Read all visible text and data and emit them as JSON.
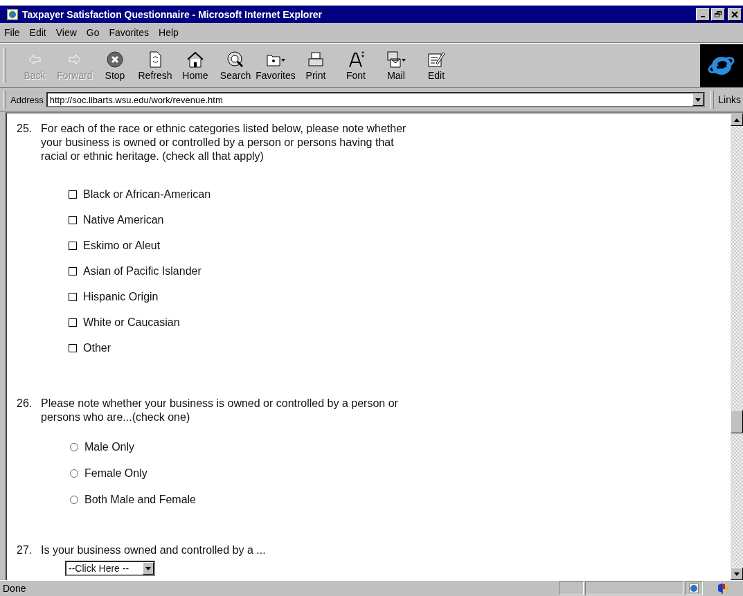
{
  "window": {
    "title": "Taxpayer Satisfaction Questionnaire - Microsoft Internet Explorer"
  },
  "menu": [
    "File",
    "Edit",
    "View",
    "Go",
    "Favorites",
    "Help"
  ],
  "toolbar": [
    {
      "kind": "back",
      "label": "Back",
      "disabled": true
    },
    {
      "kind": "forward",
      "label": "Forward",
      "disabled": true
    },
    {
      "kind": "stop",
      "label": "Stop",
      "disabled": false
    },
    {
      "kind": "refresh",
      "label": "Refresh",
      "disabled": false
    },
    {
      "kind": "home",
      "label": "Home",
      "disabled": false
    },
    {
      "kind": "search",
      "label": "Search",
      "disabled": false
    },
    {
      "kind": "favorites",
      "label": "Favorites",
      "disabled": false
    },
    {
      "kind": "print",
      "label": "Print",
      "disabled": false
    },
    {
      "kind": "font",
      "label": "Font",
      "disabled": false
    },
    {
      "kind": "mail",
      "label": "Mail",
      "disabled": false
    },
    {
      "kind": "edit",
      "label": "Edit",
      "disabled": false
    }
  ],
  "address": {
    "label": "Address",
    "value": "http://soc.libarts.wsu.edu/work/revenue.htm",
    "links": "Links"
  },
  "questions": [
    {
      "kind": "checkbox",
      "number": "25.",
      "text": "For each of the race or ethnic categories listed below, please note whether your business is owned or controlled by a person or persons having that racial or ethnic heritage. (check all that apply)",
      "options": [
        {
          "label": "Black or African-American",
          "checked": false
        },
        {
          "label": "Native American",
          "checked": false
        },
        {
          "label": "Eskimo or Aleut",
          "checked": false
        },
        {
          "label": "Asian of Pacific Islander",
          "checked": false
        },
        {
          "label": "Hispanic Origin",
          "checked": false
        },
        {
          "label": "White or Caucasian",
          "checked": false
        },
        {
          "label": "Other",
          "checked": false
        }
      ]
    },
    {
      "kind": "radio",
      "number": "26.",
      "text": "Please note whether your business is owned or controlled by a person or persons who are...(check one)",
      "options": [
        {
          "label": "Male Only",
          "selected": false
        },
        {
          "label": "Female Only",
          "selected": false
        },
        {
          "label": "Both Male and Female",
          "selected": false
        }
      ]
    },
    {
      "kind": "select",
      "number": "27.",
      "text": "Is your business owned and controlled by a ...",
      "value": "--Click Here --"
    }
  ],
  "status_bar": {
    "text": "Done"
  }
}
